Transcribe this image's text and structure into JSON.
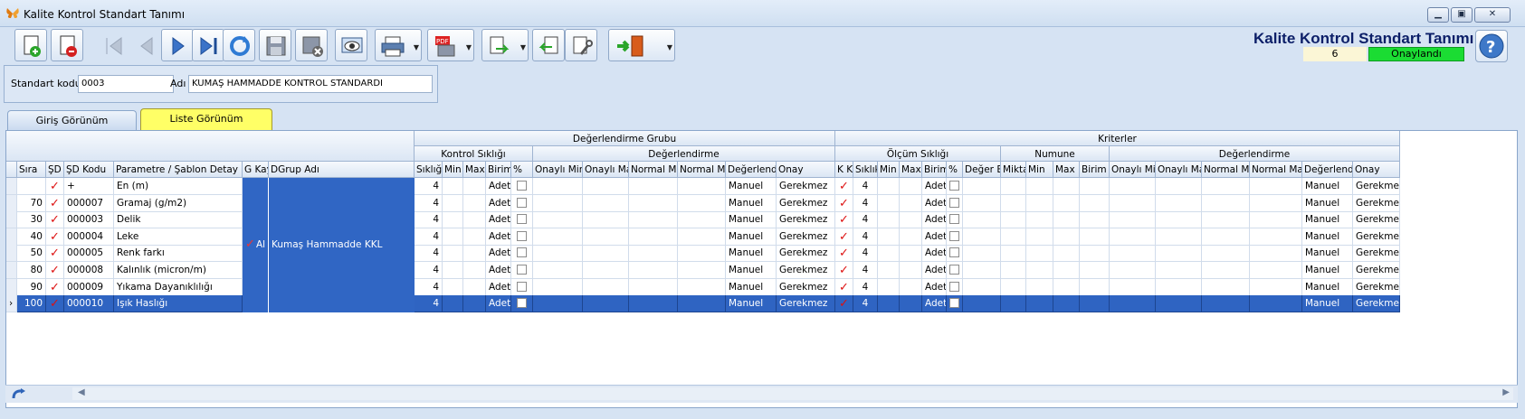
{
  "window": {
    "title": "Kalite Kontrol Standart Tanımı"
  },
  "header": {
    "title": "Kalite Kontrol Standart Tanımı",
    "record_no": "6",
    "status": "Onaylandı",
    "status_color": "#1bdc33"
  },
  "form": {
    "code_label": "Standart kodu",
    "code_value": "0003",
    "name_label": "Adı",
    "name_value": "KUMAŞ HAMMADDE KONTROL STANDARDI"
  },
  "tabs": [
    {
      "label": "Giriş Görünüm",
      "active": false
    },
    {
      "label": "Liste Görünüm",
      "active": true
    }
  ],
  "grid": {
    "band1": {
      "left": "Değerlendirme Grubu",
      "right": "Kriterler"
    },
    "band2": [
      "Kontrol Sıklığı",
      "Değerlendirme",
      "Ölçüm Sıklığı",
      "Numune",
      "Değerlendirme"
    ],
    "columns": [
      "Sıra",
      "ŞD",
      "ŞD Kodu",
      "Parametre / Şablon Detay",
      "G Kay",
      "DGrup Adı",
      "Sıklığı",
      "Min",
      "Max",
      "Birim",
      "%",
      "Onaylı Min",
      "Onaylı Max",
      "Normal Min",
      "Normal Max",
      "Değerlendir",
      "Onay",
      "K K",
      "Sıklık",
      "Min",
      "Max",
      "Birim",
      "%",
      "Değer Bir",
      "Mikta",
      "Min",
      "Max",
      "Birim",
      "Onaylı Min",
      "Onaylı Max",
      "Normal Min",
      "Normal Max",
      "Değerlendir",
      "Onay"
    ],
    "group_cell": {
      "gkay": "Al",
      "dgrup": "Kumaş Hammadde KKL"
    },
    "rows": [
      {
        "sira": "",
        "sd_kodu": "+",
        "param": "En (m)",
        "siklik": "4",
        "birim": "Adet",
        "deger": "Manuel",
        "onay": "Gerekmez",
        "k_siklik": "4",
        "k_birim": "Adet",
        "k_deger": "Manuel",
        "k_onay": "Gerekmez",
        "selected": false
      },
      {
        "sira": "70",
        "sd_kodu": "000007",
        "param": "Gramaj (g/m2)",
        "siklik": "4",
        "birim": "Adet",
        "deger": "Manuel",
        "onay": "Gerekmez",
        "k_siklik": "4",
        "k_birim": "Adet",
        "k_deger": "Manuel",
        "k_onay": "Gerekmez",
        "selected": false
      },
      {
        "sira": "30",
        "sd_kodu": "000003",
        "param": "Delik",
        "siklik": "4",
        "birim": "Adet",
        "deger": "Manuel",
        "onay": "Gerekmez",
        "k_siklik": "4",
        "k_birim": "Adet",
        "k_deger": "Manuel",
        "k_onay": "Gerekmez",
        "selected": false
      },
      {
        "sira": "40",
        "sd_kodu": "000004",
        "param": "Leke",
        "siklik": "4",
        "birim": "Adet",
        "deger": "Manuel",
        "onay": "Gerekmez",
        "k_siklik": "4",
        "k_birim": "Adet",
        "k_deger": "Manuel",
        "k_onay": "Gerekmez",
        "selected": false
      },
      {
        "sira": "50",
        "sd_kodu": "000005",
        "param": "Renk farkı",
        "siklik": "4",
        "birim": "Adet",
        "deger": "Manuel",
        "onay": "Gerekmez",
        "k_siklik": "4",
        "k_birim": "Adet",
        "k_deger": "Manuel",
        "k_onay": "Gerekmez",
        "selected": false
      },
      {
        "sira": "80",
        "sd_kodu": "000008",
        "param": "Kalınlık (micron/m)",
        "siklik": "4",
        "birim": "Adet",
        "deger": "Manuel",
        "onay": "Gerekmez",
        "k_siklik": "4",
        "k_birim": "Adet",
        "k_deger": "Manuel",
        "k_onay": "Gerekmez",
        "selected": false
      },
      {
        "sira": "90",
        "sd_kodu": "000009",
        "param": "Yıkama Dayanıklılığı",
        "siklik": "4",
        "birim": "Adet",
        "deger": "Manuel",
        "onay": "Gerekmez",
        "k_siklik": "4",
        "k_birim": "Adet",
        "k_deger": "Manuel",
        "k_onay": "Gerekmez",
        "selected": false
      },
      {
        "sira": "100",
        "sd_kodu": "000010",
        "param": "Işık Haslığı",
        "siklik": "4",
        "birim": "Adet",
        "deger": "Manuel",
        "onay": "Gerekmez",
        "k_siklik": "4",
        "k_birim": "Adet",
        "k_deger": "Manuel",
        "k_onay": "Gerekmez",
        "selected": true
      }
    ]
  },
  "icons": [
    "new-record-icon",
    "delete-record-icon",
    "first-icon",
    "prev-icon",
    "next-icon",
    "last-icon",
    "refresh-icon",
    "save-icon",
    "cancel-icon",
    "preview-icon",
    "print-icon",
    "pdf-icon",
    "export-icon",
    "import-icon",
    "tools-icon",
    "exit-icon",
    "help-icon"
  ]
}
